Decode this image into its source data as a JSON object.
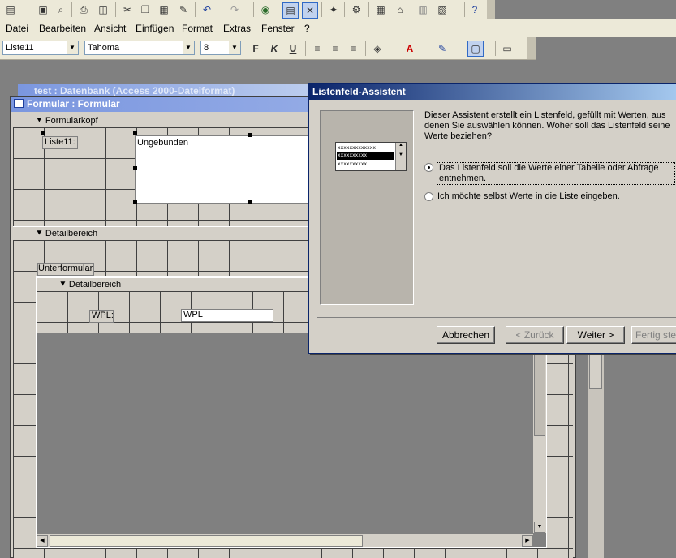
{
  "menus": [
    "Datei",
    "Bearbeiten",
    "Ansicht",
    "Einfügen",
    "Format",
    "Extras",
    "Fenster",
    "?"
  ],
  "format_bar": {
    "object": "Liste11",
    "font": "Tahoma",
    "size": "8",
    "bold": "F",
    "italic": "K",
    "underline": "U"
  },
  "db_window": {
    "title": "test : Datenbank (Access 2000-Dateiformat)"
  },
  "form_window": {
    "title": "Formular : Formular",
    "header_section": "Formularkopf",
    "detail_section": "Detailbereich",
    "list_label": "Liste11:",
    "list_text": "Ungebunden",
    "subform_label": "Unterformular",
    "sub_detail_section": "Detailbereich",
    "wpl_label": "WPL:",
    "wpl_field": "WPL"
  },
  "dialog": {
    "title": "Listenfeld-Assistent",
    "description": "Dieser Assistent erstellt ein Listenfeld, gefüllt mit Werten, aus denen Sie auswählen können. Woher soll das Listenfeld seine Werte beziehen?",
    "option1_line1": "Das Listenfeld soll die Werte einer Tabelle oder Abfrage",
    "option1_line2": "entnehmen.",
    "option2": "Ich möchte selbst Werte in die Liste eingeben.",
    "preview_items": [
      "xxxxxxxxxxxxx",
      "xxxxxxxxxx",
      "xxxxxxxxxx"
    ],
    "cancel": "Abbrechen",
    "back": "< Zurück",
    "next": "Weiter >",
    "finish": "Fertig stellen"
  }
}
